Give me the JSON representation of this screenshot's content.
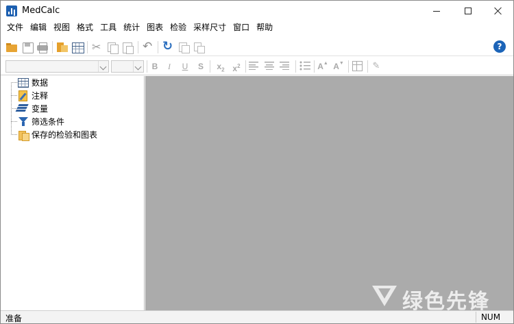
{
  "window": {
    "title": "MedCalc"
  },
  "menu": {
    "items": [
      "文件",
      "编辑",
      "视图",
      "格式",
      "工具",
      "统计",
      "图表",
      "检验",
      "采样尺寸",
      "窗口",
      "帮助"
    ]
  },
  "toolbar": {
    "icons": [
      "open-icon",
      "save-icon",
      "print-icon",
      "folder-icon",
      "spreadsheet-icon",
      "cut-icon",
      "copy-icon",
      "paste-icon",
      "undo-icon",
      "refresh-icon",
      "duplicate-icon",
      "duplicate-alt-icon",
      "help-icon"
    ],
    "help_label": "?"
  },
  "format_toolbar": {
    "bold": "B",
    "italic": "I",
    "underline": "U",
    "strike": "S",
    "subscript_base": "x",
    "subscript_mark": "2",
    "superscript_base": "x",
    "superscript_mark": "2",
    "font_grow": "A",
    "font_grow_mark": "▲",
    "font_shrink": "A",
    "font_shrink_mark": "▼"
  },
  "tree": {
    "items": [
      {
        "label": "数据",
        "icon": "data-sheet-icon"
      },
      {
        "label": "注释",
        "icon": "notes-icon"
      },
      {
        "label": "变量",
        "icon": "variables-icon"
      },
      {
        "label": "筛选条件",
        "icon": "filter-icon"
      },
      {
        "label": "保存的检验和图表",
        "icon": "saved-items-icon"
      }
    ]
  },
  "status": {
    "text": "准备",
    "num": "NUM"
  },
  "watermark": {
    "text": "绿色先锋"
  },
  "colors": {
    "content_bg": "#ababab",
    "accent_blue": "#1c64b8",
    "folder_orange": "#e7a434"
  }
}
